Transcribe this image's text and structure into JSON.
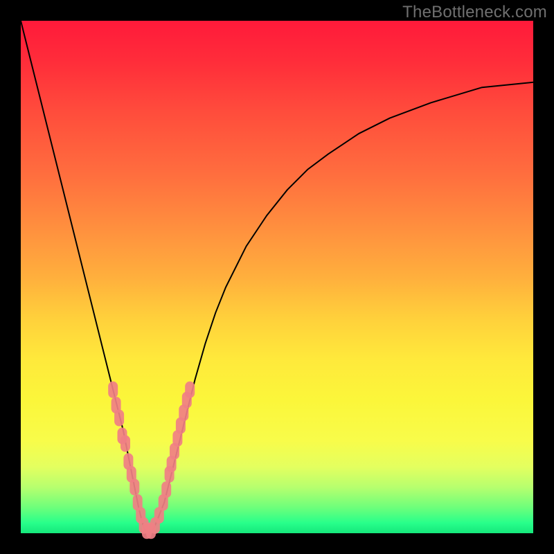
{
  "watermark": {
    "text": "TheBottleneck.com"
  },
  "colors": {
    "curve_stroke": "#000000",
    "marker_fill": "#f07f84",
    "marker_stroke": "#f07f84"
  },
  "chart_data": {
    "type": "line",
    "title": "",
    "xlabel": "",
    "ylabel": "",
    "xlim": [
      0,
      100
    ],
    "ylim": [
      0,
      100
    ],
    "series": [
      {
        "name": "bottleneck-curve",
        "x": [
          0,
          2,
          4,
          6,
          8,
          10,
          12,
          14,
          16,
          18,
          20,
          22,
          23,
          24,
          25,
          26,
          28,
          30,
          32,
          34,
          36,
          38,
          40,
          44,
          48,
          52,
          56,
          60,
          66,
          72,
          80,
          90,
          100
        ],
        "y": [
          100,
          92,
          84,
          76,
          68,
          60,
          52,
          44,
          36,
          28,
          20,
          10,
          5,
          1,
          0,
          1,
          6,
          14,
          22,
          30,
          37,
          43,
          48,
          56,
          62,
          67,
          71,
          74,
          78,
          81,
          84,
          87,
          88
        ]
      }
    ],
    "markers": {
      "name": "sample-points",
      "points": [
        {
          "x": 18.0,
          "y": 28.0
        },
        {
          "x": 18.6,
          "y": 25.0
        },
        {
          "x": 19.2,
          "y": 22.5
        },
        {
          "x": 19.8,
          "y": 19.0
        },
        {
          "x": 20.4,
          "y": 17.5
        },
        {
          "x": 21.0,
          "y": 14.0
        },
        {
          "x": 21.6,
          "y": 11.5
        },
        {
          "x": 22.2,
          "y": 9.0
        },
        {
          "x": 22.8,
          "y": 6.0
        },
        {
          "x": 23.4,
          "y": 3.5
        },
        {
          "x": 24.0,
          "y": 1.5
        },
        {
          "x": 24.6,
          "y": 0.5
        },
        {
          "x": 25.4,
          "y": 0.5
        },
        {
          "x": 26.2,
          "y": 1.5
        },
        {
          "x": 27.0,
          "y": 3.5
        },
        {
          "x": 27.8,
          "y": 6.0
        },
        {
          "x": 28.4,
          "y": 8.5
        },
        {
          "x": 29.0,
          "y": 11.5
        },
        {
          "x": 29.4,
          "y": 13.5
        },
        {
          "x": 30.0,
          "y": 16.0
        },
        {
          "x": 30.6,
          "y": 18.5
        },
        {
          "x": 31.2,
          "y": 21.0
        },
        {
          "x": 31.8,
          "y": 23.5
        },
        {
          "x": 32.4,
          "y": 26.0
        },
        {
          "x": 33.0,
          "y": 28.0
        }
      ]
    }
  }
}
